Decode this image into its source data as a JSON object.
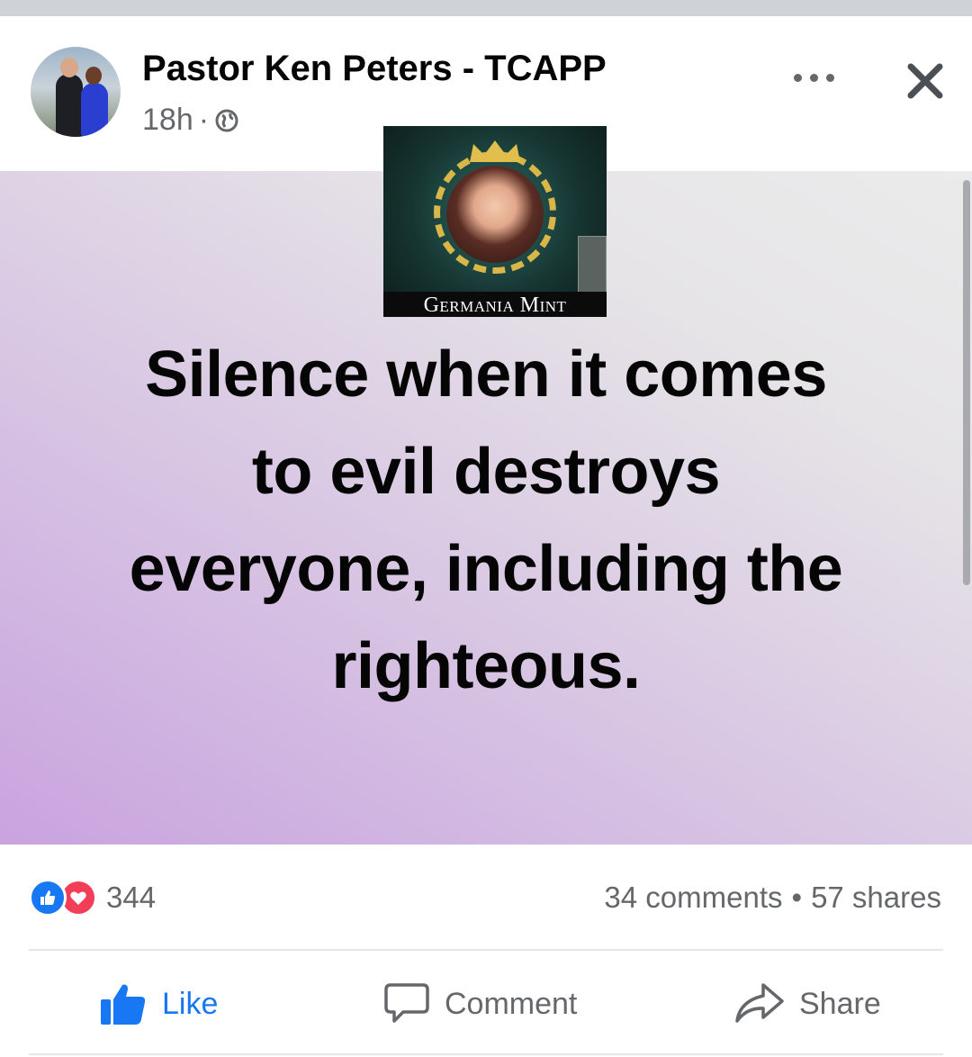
{
  "post": {
    "author": "Pastor Ken Peters - TCAPP",
    "timestamp": "18h",
    "separator": "·",
    "privacy_icon": "globe-icon",
    "more_icon": "more-options-icon",
    "close_icon": "close-icon"
  },
  "ad_image": {
    "caption": "Germania Mint"
  },
  "content": {
    "background_colors": [
      "#c9a3df",
      "#ebebeb"
    ],
    "lines": [
      "Silence when it comes",
      "to evil destroys",
      "everyone, including the",
      "righteous."
    ]
  },
  "stats": {
    "reaction_count": "344",
    "comments": "34 comments",
    "separator": "•",
    "shares": "57 shares",
    "reaction_icons": [
      "like-reaction-icon",
      "love-reaction-icon"
    ]
  },
  "actions": {
    "like": "Like",
    "comment": "Comment",
    "share": "Share"
  },
  "colors": {
    "accent": "#1877f2",
    "love": "#f33e58",
    "secondary_text": "#65676b"
  }
}
